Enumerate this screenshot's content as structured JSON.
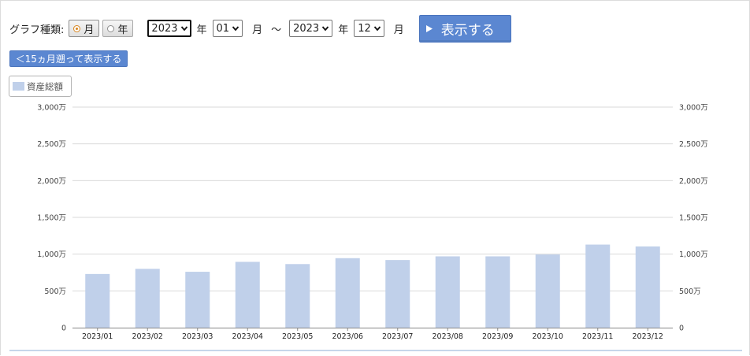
{
  "controls": {
    "graph_type_label": "グラフ種類:",
    "radio_month": "月",
    "radio_year": "年",
    "selected_period": "月",
    "from_year": "2023",
    "from_month": "01",
    "to_year": "2023",
    "to_month": "12",
    "year_unit": "年",
    "month_unit": "月",
    "tilde": "～",
    "show_button": "表示する"
  },
  "back_button": "＜15ヵ月遡って表示する",
  "legend": {
    "label": "資産総額",
    "color": "#c0d0ea"
  },
  "chart_data": {
    "type": "bar",
    "categories": [
      "2023/01",
      "2023/02",
      "2023/03",
      "2023/04",
      "2023/05",
      "2023/06",
      "2023/07",
      "2023/08",
      "2023/09",
      "2023/10",
      "2023/11",
      "2023/12"
    ],
    "series": [
      {
        "name": "資産総額",
        "values": [
          730,
          800,
          760,
          895,
          865,
          945,
          920,
          970,
          970,
          995,
          1130,
          1105
        ],
        "color": "#c0d0ea"
      }
    ],
    "unit": "万",
    "ylim": [
      0,
      3000
    ],
    "yticks": [
      0,
      500,
      1000,
      1500,
      2000,
      2500,
      3000
    ],
    "ytick_labels": [
      "0",
      "500万",
      "1,000万",
      "1,500万",
      "2,000万",
      "2,500万",
      "3,000万"
    ],
    "grid": true,
    "right_axis": true
  }
}
